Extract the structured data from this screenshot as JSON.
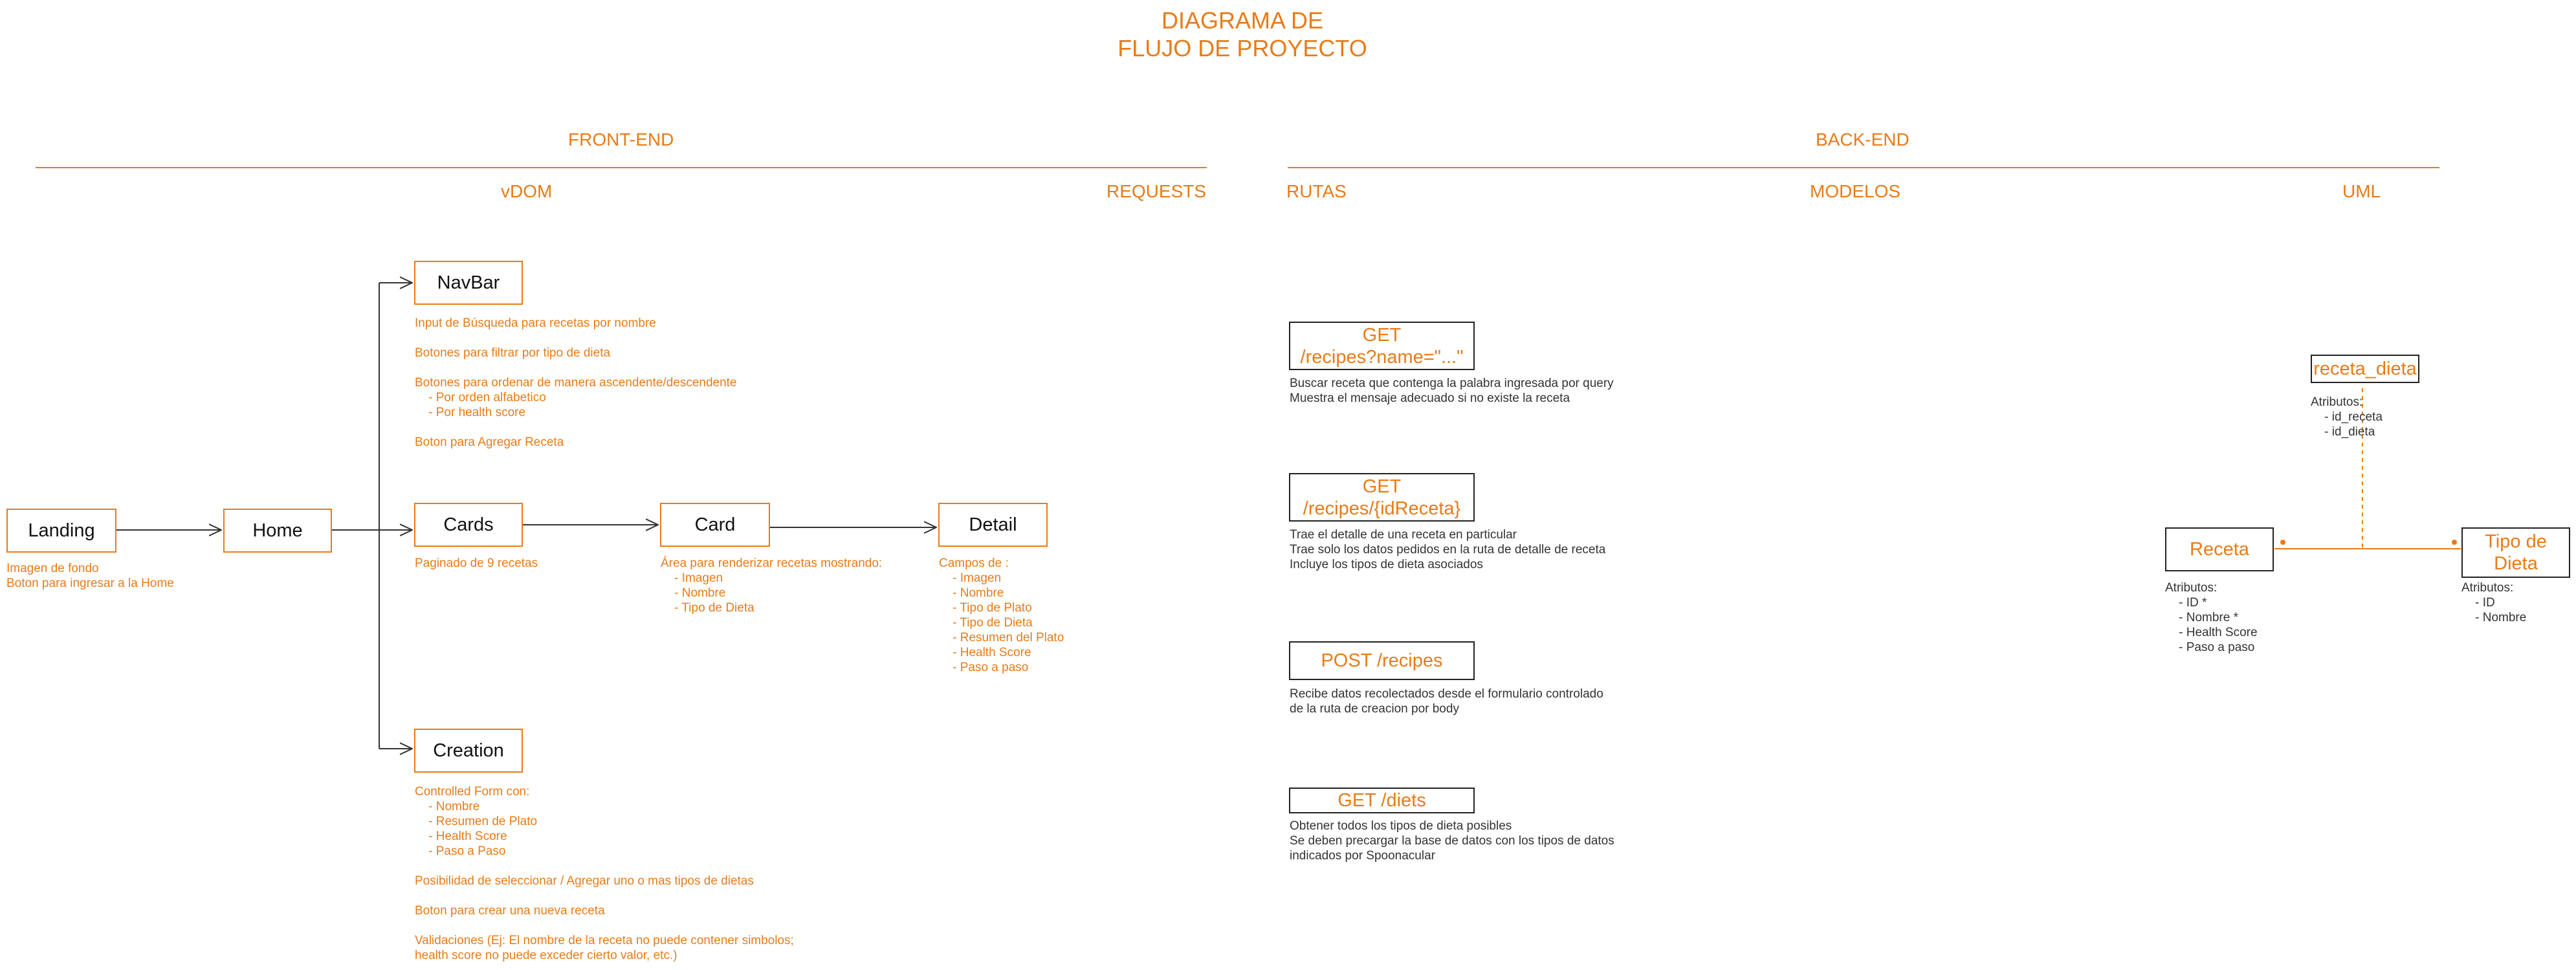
{
  "title": {
    "line1": "DIAGRAMA DE",
    "line2": "FLUJO DE PROYECTO"
  },
  "sections": {
    "frontend": "FRONT-END",
    "backend": "BACK-END",
    "vdom": "vDOM",
    "requests": "REQUESTS",
    "rutas": "RUTAS",
    "modelos": "MODELOS",
    "uml": "UML"
  },
  "nodes": {
    "landing": "Landing",
    "home": "Home",
    "navbar": "NavBar",
    "cards": "Cards",
    "card": "Card",
    "detail": "Detail",
    "creation": "Creation"
  },
  "notes": {
    "landing": "Imagen de fondo\nBoton para ingresar a la Home",
    "navbar": "Input de Búsqueda para recetas por nombre\n\nBotones para filtrar por tipo de dieta\n\nBotones para ordenar de manera ascendente/descendente\n    - Por orden alfabetico\n    - Por health score\n\nBoton para Agregar Receta",
    "cards": "Paginado de 9 recetas",
    "card": "Área para renderizar recetas mostrando:\n    - Imagen\n    - Nombre\n    - Tipo de Dieta",
    "detail": "Campos de :\n    - Imagen\n    - Nombre\n    - Tipo de Plato\n    - Tipo de Dieta\n    - Resumen del Plato\n    - Health Score\n    - Paso a paso",
    "creation": "Controlled Form con:\n    - Nombre\n    - Resumen de Plato\n    - Health Score\n    - Paso a Paso\n\nPosibilidad de seleccionar / Agregar uno o mas tipos de dietas\n\nBoton para crear una nueva receta\n\nValidaciones (Ej: El nombre de la receta no puede contener simbolos;\nhealth score no puede exceder cierto valor, etc.)"
  },
  "routes": [
    {
      "label": "GET\n/recipes?name=\"...\"",
      "desc": "Buscar receta que contenga la palabra ingresada por query\nMuestra el mensaje adecuado si no existe la receta"
    },
    {
      "label": "GET\n/recipes/{idReceta}",
      "desc": "Trae el detalle de una receta en particular\nTrae solo los datos pedidos en la ruta de detalle de receta\nIncluye los tipos de dieta asociados"
    },
    {
      "label": "POST /recipes",
      "desc": "Recibe datos recolectados desde el formulario controlado\nde la ruta de creacion por body"
    },
    {
      "label": "GET /diets",
      "desc": "Obtener todos los tipos de dieta posibles\nSe deben precargar la base de datos con los tipos de datos\nindicados por Spoonacular"
    }
  ],
  "uml": {
    "join": {
      "label": "receta_dieta",
      "attrs": "Atributos:\n    - id_receta\n    - id_dieta"
    },
    "receta": {
      "label": "Receta",
      "attrs": "Atributos:\n    - ID *\n    - Nombre *\n    - Health Score\n    - Paso a paso"
    },
    "tipo": {
      "label": "Tipo de\nDieta",
      "attrs": "Atributos:\n    - ID\n    - Nombre"
    }
  },
  "colors": {
    "accent": "#E87B17",
    "dark": "#333333"
  }
}
